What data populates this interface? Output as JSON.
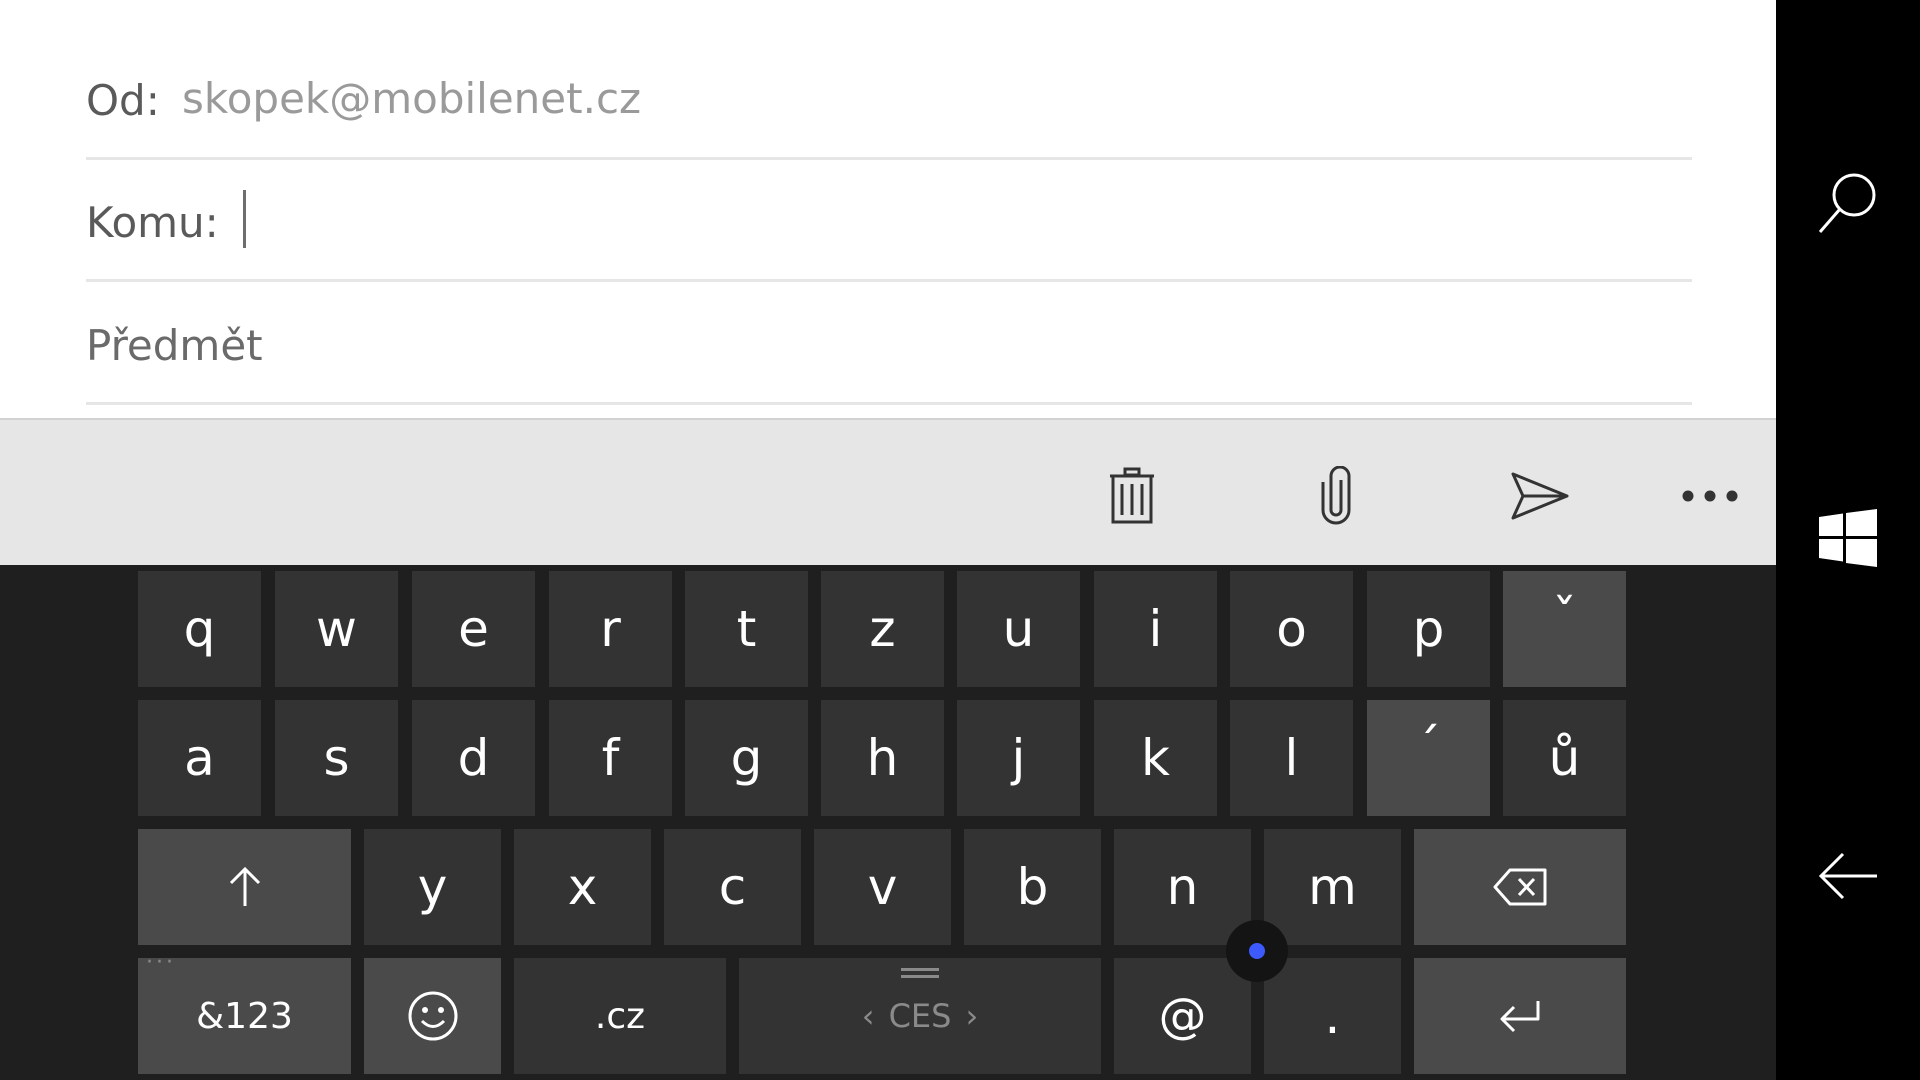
{
  "compose": {
    "from_label": "Od:",
    "from_value": "skopek@mobilenet.cz",
    "to_label": "Komu:",
    "to_value": "",
    "subject_placeholder": "Předmět"
  },
  "commands": {
    "delete_icon": "trash-icon",
    "attach_icon": "paperclip-icon",
    "send_icon": "send-icon",
    "more_icon": "more-icon"
  },
  "keyboard": {
    "row1": [
      "q",
      "w",
      "e",
      "r",
      "t",
      "z",
      "u",
      "i",
      "o",
      "p",
      "ˇ"
    ],
    "row2": [
      "a",
      "s",
      "d",
      "f",
      "g",
      "h",
      "j",
      "k",
      "l",
      "´",
      "ů"
    ],
    "row3": [
      "y",
      "x",
      "c",
      "v",
      "b",
      "n",
      "m"
    ],
    "symbols_label": "&123",
    "domain_label": ".cz",
    "language_label": "CES",
    "at_label": "@",
    "period_label": ".",
    "shift_icon": "shift-arrow-icon",
    "backspace_icon": "backspace-icon",
    "enter_icon": "enter-icon",
    "emoji_icon": "emoji-icon"
  },
  "nav": {
    "search_icon": "search-icon",
    "windows_icon": "windows-logo-icon",
    "back_icon": "back-arrow-icon"
  },
  "colors": {
    "accent_dot": "#3d5afe",
    "keyboard_bg": "#1f1f1f",
    "key_bg": "#333333",
    "function_key_bg": "#4a4a4a"
  }
}
